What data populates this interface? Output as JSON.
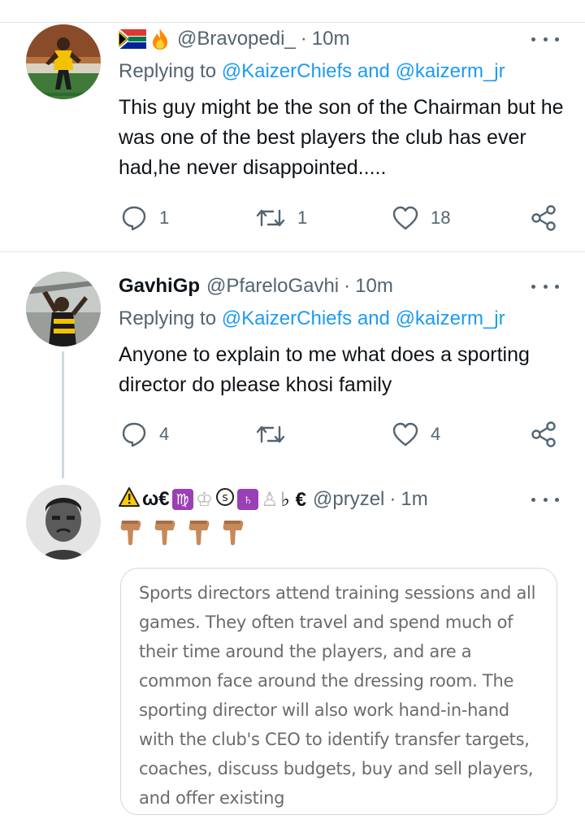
{
  "tweets": [
    {
      "handle": "@Bravopedi_",
      "separator": "·",
      "time": "10m",
      "replying_prefix": "Replying to",
      "mention1": "@KaizerChiefs",
      "and": "and",
      "mention2": "@kaizerm_jr",
      "body": "This guy might be the son of the Chairman but he was one of the best players the club has ever had,he never disappointed.....",
      "replies": "1",
      "retweets": "1",
      "likes": "18"
    },
    {
      "display_name": "GavhiGp",
      "handle": "@PfareloGavhi",
      "separator": "·",
      "time": "10m",
      "replying_prefix": "Replying to",
      "mention1": "@KaizerChiefs",
      "and": "and",
      "mention2": "@kaizerm_jr",
      "body": "Anyone to explain to me what does a sporting director do please khosi family",
      "replies": "4",
      "retweets": "",
      "likes": "4"
    },
    {
      "display_name_text": "ω€",
      "display_name_tail": "♭ €",
      "handle": "@pryzel",
      "separator": "·",
      "time": "1m",
      "quote_text": "Sports directors attend training sessions and all games. They often travel and spend much of their time around the players, and are a common face around the dressing room. The sporting director will also work hand-in-hand with the club's CEO to identify transfer targets, coaches, discuss budgets, buy and sell players, and offer existing"
    }
  ],
  "icons": [
    "reply-icon",
    "retweet-icon",
    "like-icon",
    "share-icon",
    "more-icon"
  ],
  "colors": {
    "link": "#1d9bf0",
    "secondary": "#536471",
    "text": "#0f1419"
  }
}
